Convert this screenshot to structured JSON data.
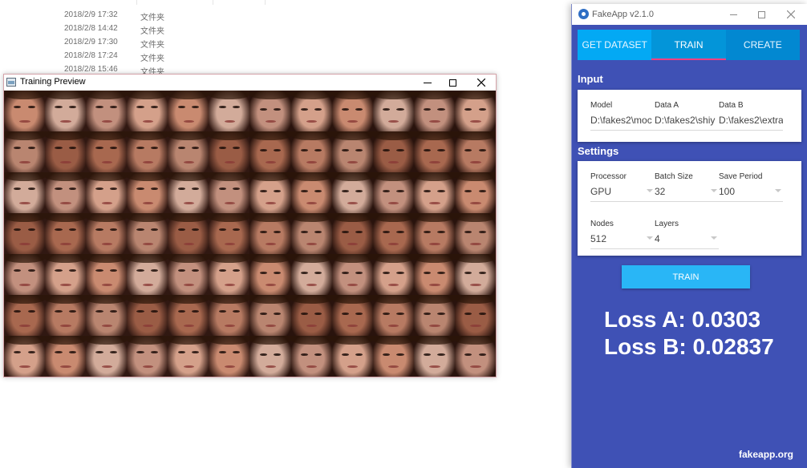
{
  "explorer": {
    "rows": [
      {
        "date": "2018/2/9 17:32",
        "type": "文件夹"
      },
      {
        "date": "2018/2/8 14:42",
        "type": "文件夹"
      },
      {
        "date": "2018/2/9 17:30",
        "type": "文件夹"
      },
      {
        "date": "2018/2/8 17:24",
        "type": "文件夹"
      },
      {
        "date": "2018/2/8 15:46",
        "type": "文件夹"
      }
    ]
  },
  "preview": {
    "title": "Training Preview",
    "grid": {
      "columns": 12,
      "rows": 7
    },
    "face_tones": [
      "#c98a70",
      "#b77a62",
      "#d4a08a",
      "#a8684f",
      "#c2907e",
      "#9a5c45",
      "#d2ab9a",
      "#b98570"
    ]
  },
  "fakeapp": {
    "title": "FakeApp v2.1.0",
    "tabs": [
      {
        "label": "GET DATASET"
      },
      {
        "label": "TRAIN"
      },
      {
        "label": "CREATE"
      }
    ],
    "input": {
      "heading": "Input",
      "fields": [
        {
          "label": "Model",
          "value": "D:\\fakes2\\moc"
        },
        {
          "label": "Data A",
          "value": "D:\\fakes2\\shiy"
        },
        {
          "label": "Data B",
          "value": "D:\\fakes2\\extra"
        }
      ]
    },
    "settings": {
      "heading": "Settings",
      "fields": [
        {
          "label": "Processor",
          "value": "GPU"
        },
        {
          "label": "Batch Size",
          "value": "32"
        },
        {
          "label": "Save Period",
          "value": "100"
        },
        {
          "label": "Nodes",
          "value": "512"
        },
        {
          "label": "Layers",
          "value": "4"
        }
      ]
    },
    "train_button": "TRAIN",
    "loss_a": "Loss A: 0.0303",
    "loss_b": "Loss B: 0.02837",
    "footer": "fakeapp.org",
    "colors": {
      "background": "#3f51b5",
      "tab_bar": "#03a9f4",
      "accent": "#ff4081",
      "button": "#29b6f6"
    }
  }
}
